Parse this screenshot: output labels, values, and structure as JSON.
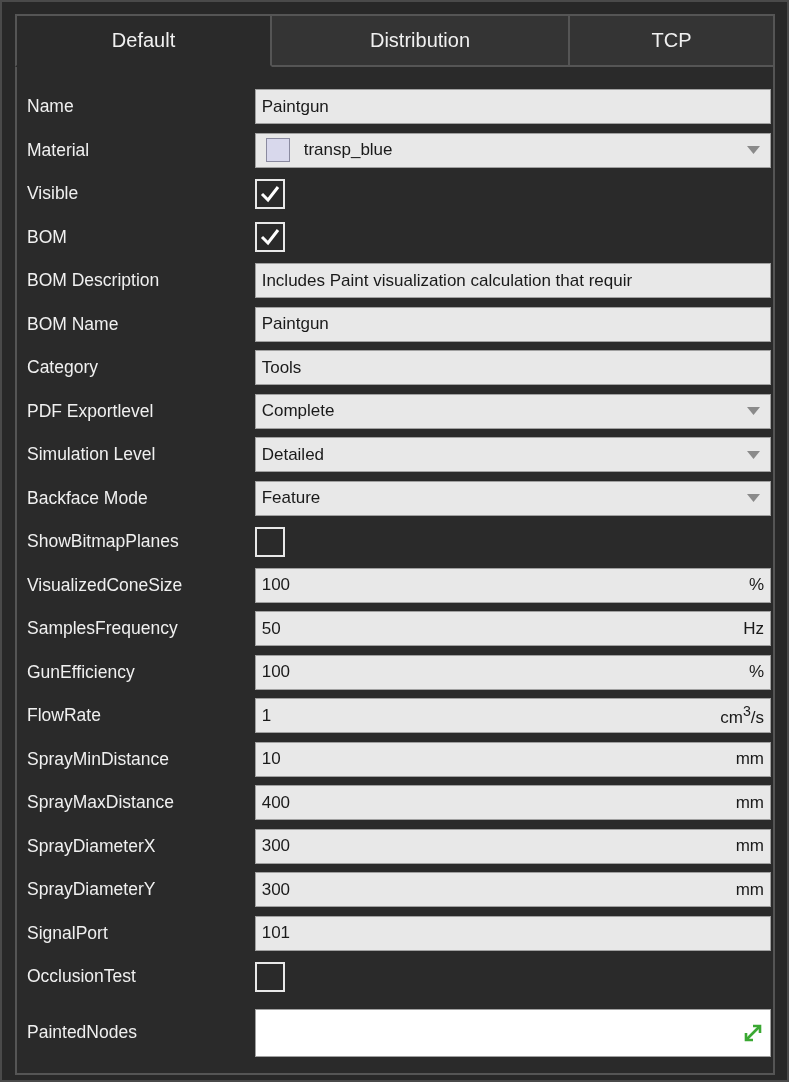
{
  "tabs": [
    {
      "label": "Default",
      "selected": true
    },
    {
      "label": "Distribution",
      "selected": false
    },
    {
      "label": "TCP",
      "selected": false
    }
  ],
  "properties": [
    {
      "kind": "text",
      "label": "Name",
      "value": "Paintgun"
    },
    {
      "kind": "dropdown",
      "label": "Material",
      "value": "transp_blue",
      "color": "#d8d8ec"
    },
    {
      "kind": "checkbox",
      "label": "Visible",
      "checked": true
    },
    {
      "kind": "checkbox",
      "label": "BOM",
      "checked": true
    },
    {
      "kind": "text",
      "label": "BOM Description",
      "value": "Includes Paint visualization calculation that requir"
    },
    {
      "kind": "text",
      "label": "BOM Name",
      "value": "Paintgun"
    },
    {
      "kind": "text",
      "label": "Category",
      "value": "Tools"
    },
    {
      "kind": "dropdown",
      "label": "PDF Exportlevel",
      "value": "Complete"
    },
    {
      "kind": "dropdown",
      "label": "Simulation Level",
      "value": "Detailed"
    },
    {
      "kind": "dropdown",
      "label": "Backface Mode",
      "value": "Feature"
    },
    {
      "kind": "checkbox",
      "label": "ShowBitmapPlanes",
      "checked": false
    },
    {
      "kind": "unit",
      "label": "VisualizedConeSize",
      "value": "100",
      "unit": "%"
    },
    {
      "kind": "unit",
      "label": "SamplesFrequency",
      "value": "50",
      "unit": "Hz"
    },
    {
      "kind": "unit",
      "label": "GunEfficiency",
      "value": "100",
      "unit": "%"
    },
    {
      "kind": "unit",
      "label": "FlowRate",
      "value": "1",
      "unit": "cm$^{3}$/s"
    },
    {
      "kind": "unit",
      "label": "SprayMinDistance",
      "value": "10",
      "unit": "mm"
    },
    {
      "kind": "unit",
      "label": "SprayMaxDistance",
      "value": "400",
      "unit": "mm"
    },
    {
      "kind": "unit",
      "label": "SprayDiameterX",
      "value": "300",
      "unit": "mm"
    },
    {
      "kind": "unit",
      "label": "SprayDiameterY",
      "value": "300",
      "unit": "mm"
    },
    {
      "kind": "text",
      "label": "SignalPort",
      "value": "101"
    },
    {
      "kind": "checkbox",
      "label": "OcclusionTest",
      "checked": false
    },
    {
      "kind": "expand",
      "label": "PaintedNodes"
    }
  ]
}
